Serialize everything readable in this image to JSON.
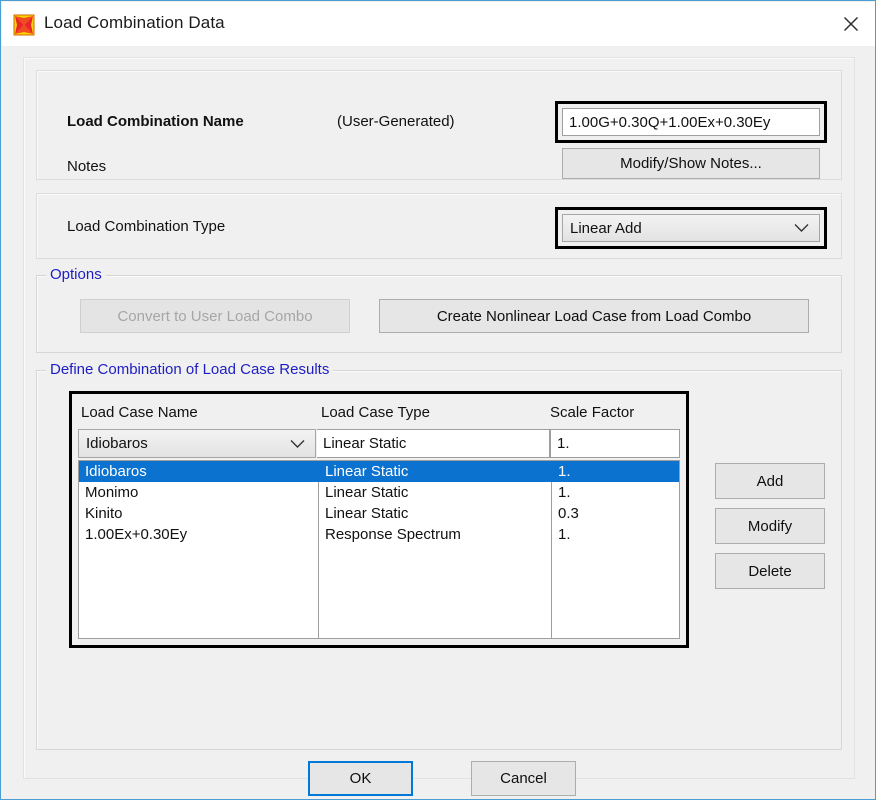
{
  "window": {
    "title": "Load Combination Data",
    "app_icon": "sap2000-star-icon",
    "close_icon": "close-icon"
  },
  "name_section": {
    "label": "Load Combination Name",
    "origin_note": "(User-Generated)",
    "value": "1.00G+0.30Q+1.00Ex+0.30Ey",
    "notes_label": "Notes",
    "notes_button": "Modify/Show Notes..."
  },
  "type_section": {
    "label": "Load Combination Type",
    "selected": "Linear Add",
    "chevron_icon": "chevron-down-icon"
  },
  "options": {
    "legend": "Options",
    "convert_button": "Convert to User Load Combo",
    "convert_disabled": true,
    "create_button": "Create Nonlinear Load Case from Load Combo"
  },
  "define": {
    "legend": "Define Combination of Load Case Results",
    "headers": {
      "name": "Load Case Name",
      "type": "Load Case Type",
      "scale": "Scale Factor"
    },
    "editor": {
      "name": "Idiobaros",
      "type": "Linear Static",
      "scale": "1.",
      "chevron_icon": "chevron-down-icon"
    },
    "rows": [
      {
        "name": "Idiobaros",
        "type": "Linear Static",
        "scale": "1.",
        "selected": true
      },
      {
        "name": "Monimo",
        "type": "Linear Static",
        "scale": "1.",
        "selected": false
      },
      {
        "name": "Kinito",
        "type": "Linear Static",
        "scale": "0.3",
        "selected": false
      },
      {
        "name": "1.00Ex+0.30Ey",
        "type": "Response Spectrum",
        "scale": "1.",
        "selected": false
      }
    ],
    "side_buttons": {
      "add": "Add",
      "modify": "Modify",
      "delete": "Delete"
    }
  },
  "footer": {
    "ok": "OK",
    "cancel": "Cancel"
  },
  "colors": {
    "selection_blue": "#0b72d0",
    "legend_blue": "#1d1dc4",
    "focus_blue": "#0078d7",
    "dialog_gray": "#f0f0f0",
    "highlight_black": "#000000"
  }
}
